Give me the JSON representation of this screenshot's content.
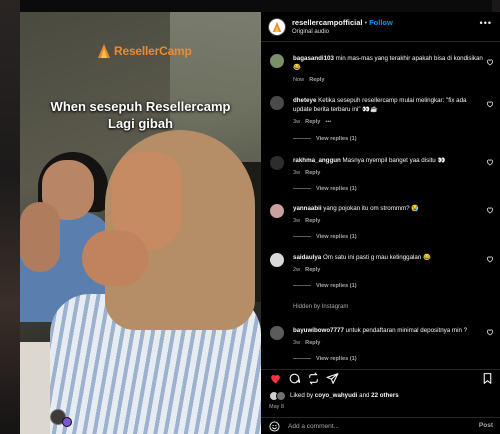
{
  "media": {
    "brand_logo": "ResellerCamp",
    "caption_line1": "When sesepuh Resellercamp",
    "caption_line2": "Lagi gibah"
  },
  "header": {
    "username": "resellercampofficial",
    "separator": "•",
    "follow_label": "Follow",
    "audio_label": "Original audio",
    "more_icon": "more-horizontal-icon"
  },
  "comments": [
    {
      "user": "bagasandi103",
      "text": "min mas-mas yang terakhir apakah bisa di kondisikan 😂",
      "time": "Now",
      "reply_label": "Reply",
      "show_more": false,
      "replies_label": ""
    },
    {
      "user": "dheteye",
      "text": "Ketika sesepuh resellercamp mulai melingkar: \"fix ada update berita terbaru ini\" 👀☕",
      "time": "3w",
      "reply_label": "Reply",
      "show_more": true,
      "replies_label": "View replies (1)"
    },
    {
      "user": "rakhma_anggun",
      "text": "Masnya nyempil banget yaa disitu 👀",
      "time": "3w",
      "reply_label": "Reply",
      "show_more": false,
      "replies_label": "View replies (1)"
    },
    {
      "user": "yannaabii",
      "text": "yang pojokan itu om strommm? 😭",
      "time": "3w",
      "reply_label": "Reply",
      "show_more": false,
      "replies_label": "View replies (1)"
    },
    {
      "user": "saidaulya",
      "text": "Om satu ini pasti g mau ketinggalan 😂",
      "time": "2w",
      "reply_label": "Reply",
      "show_more": false,
      "replies_label": "View replies (1)"
    },
    {
      "user": "bayuwibowo7777",
      "text": "untuk pendaftaran minimal depositnya min ?",
      "time": "3w",
      "reply_label": "Reply",
      "show_more": false,
      "replies_label": "View replies (1)"
    }
  ],
  "hidden_notice": "Hidden by Instagram",
  "actions": {
    "like_icon": "heart-icon",
    "comment_icon": "comment-icon",
    "repost_icon": "repost-icon",
    "share_icon": "share-icon",
    "save_icon": "bookmark-icon"
  },
  "likes": {
    "prefix": "Liked by ",
    "user": "coyo_wahyudi",
    "middle": " and ",
    "others": "22 others"
  },
  "date": "May 8",
  "add_comment": {
    "placeholder": "Add a comment...",
    "post_label": "Post"
  },
  "colors": {
    "accent": "#0095f6",
    "like_red": "#ff3040",
    "brand_orange": "#ef8a2b"
  }
}
